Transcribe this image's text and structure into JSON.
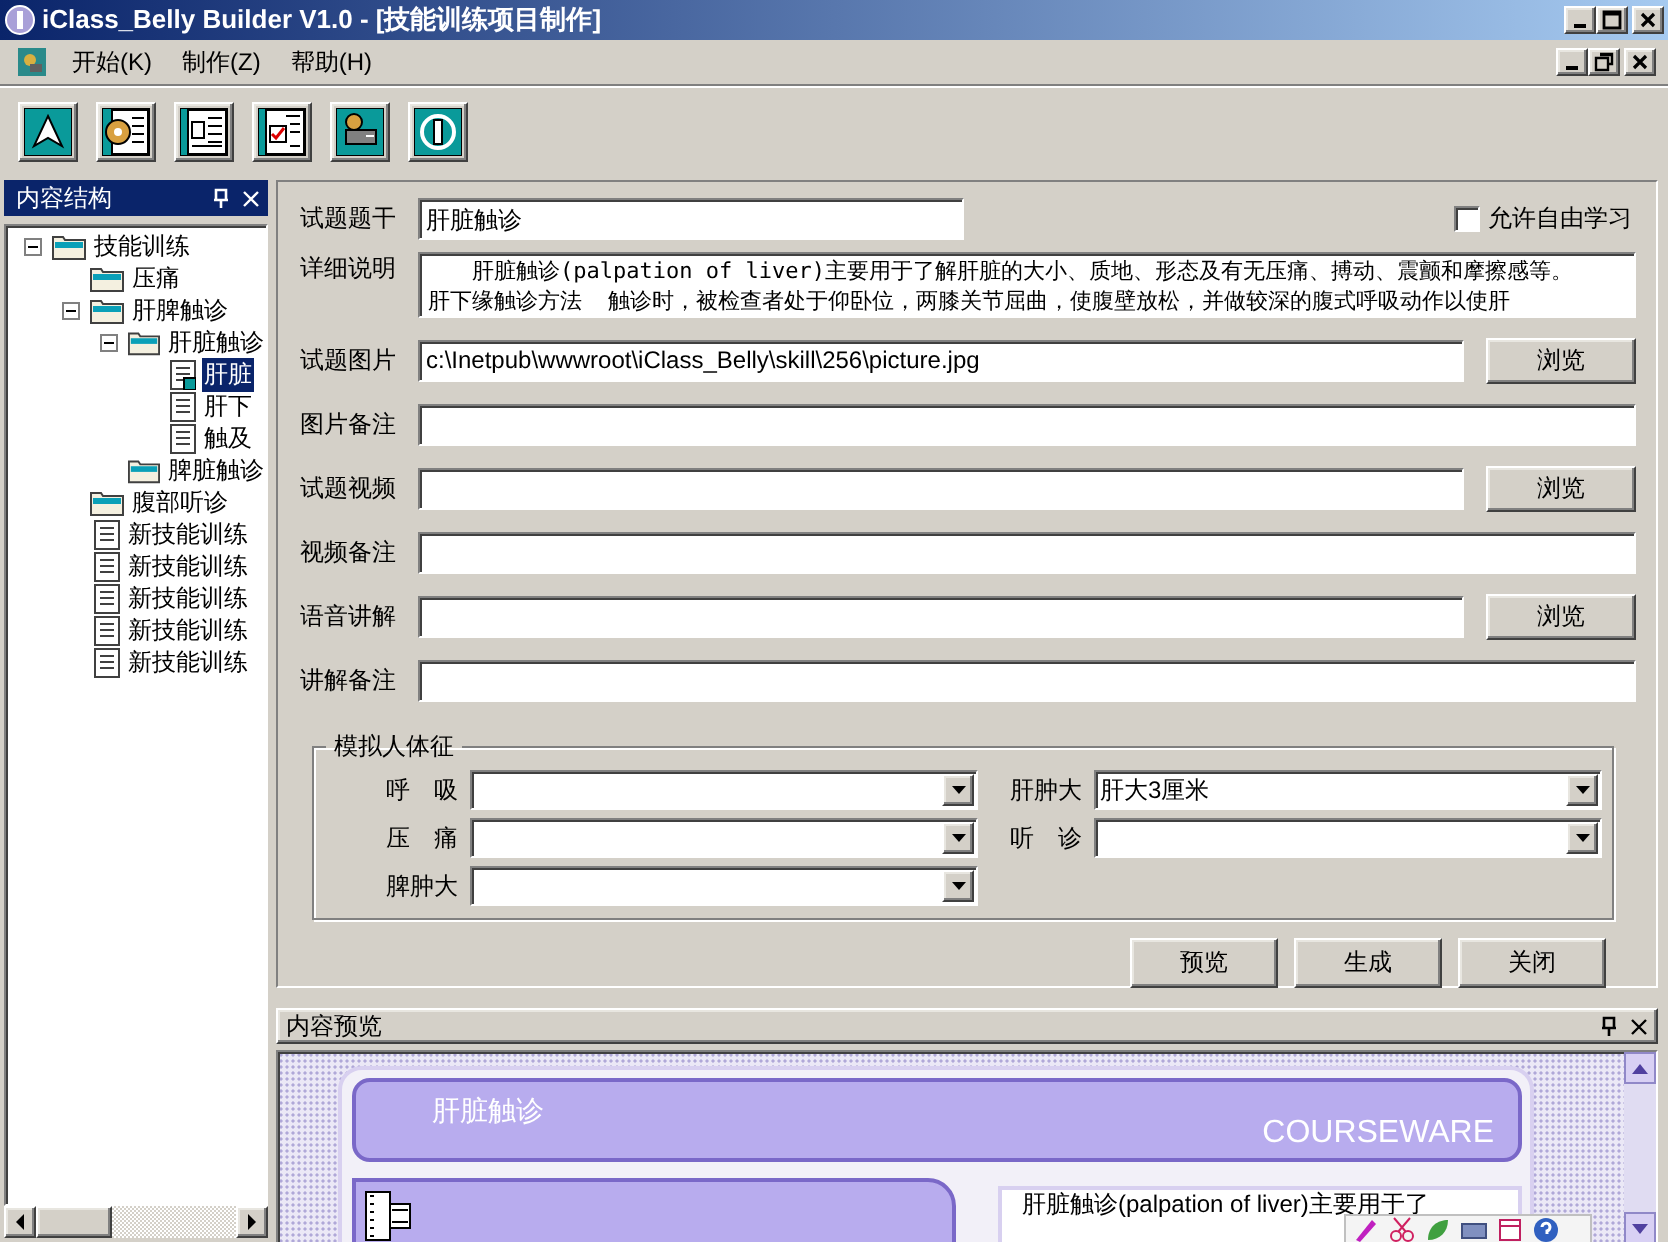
{
  "window": {
    "title": "iClass_Belly Builder V1.0 - [技能训练项目制作]"
  },
  "menu": [
    "开始(K)",
    "制作(Z)",
    "帮助(H)"
  ],
  "tree_panel": {
    "title": "内容结构",
    "tree": [
      {
        "label": "技能训练",
        "kind": "folder",
        "expanded": true,
        "selected": false,
        "children": [
          {
            "label": "压痛",
            "kind": "folder",
            "selected": false
          },
          {
            "label": "肝脾触诊",
            "kind": "folder",
            "expanded": true,
            "selected": false,
            "children": [
              {
                "label": "肝脏触诊",
                "kind": "folder",
                "expanded": true,
                "selected": false,
                "children": [
                  {
                    "label": "肝脏",
                    "kind": "page",
                    "selected": true
                  },
                  {
                    "label": "肝下",
                    "kind": "page",
                    "selected": false
                  },
                  {
                    "label": "触及",
                    "kind": "page",
                    "selected": false
                  }
                ]
              },
              {
                "label": "脾脏触诊",
                "kind": "folder",
                "selected": false
              }
            ]
          },
          {
            "label": "腹部听诊",
            "kind": "folder",
            "selected": false
          },
          {
            "label": "新技能训练",
            "kind": "page",
            "selected": false
          },
          {
            "label": "新技能训练",
            "kind": "page",
            "selected": false
          },
          {
            "label": "新技能训练",
            "kind": "page",
            "selected": false
          },
          {
            "label": "新技能训练",
            "kind": "page",
            "selected": false
          },
          {
            "label": "新技能训练",
            "kind": "page",
            "selected": false
          }
        ]
      }
    ]
  },
  "form": {
    "allow_free_study": {
      "label": "允许自由学习",
      "checked": false
    },
    "fields": [
      {
        "kind": "text",
        "label": "试题题干",
        "value": "肝脏触诊"
      },
      {
        "kind": "memo",
        "label": "详细说明",
        "lines": [
          "肝脏触诊(palpation of liver)主要用于了解肝脏的大小、质地、形态及有无压痛、搏动、震颤和摩擦感等。",
          "肝下缘触诊方法  触诊时，被检查者处于仰卧位，两膝关节屈曲，使腹壁放松，并做较深的腹式呼吸动作以使肝"
        ]
      },
      {
        "kind": "browse",
        "label": "试题图片",
        "value": "c:\\Inetpub\\wwwroot\\iClass_Belly\\skill\\256\\picture.jpg",
        "button": "浏览"
      },
      {
        "kind": "wide",
        "label": "图片备注"
      },
      {
        "kind": "browse",
        "label": "试题视频",
        "button": "浏览"
      },
      {
        "kind": "wide",
        "label": "视频备注"
      },
      {
        "kind": "browse",
        "label": "语音讲解",
        "button": "浏览"
      },
      {
        "kind": "wide",
        "label": "讲解备注"
      }
    ],
    "vitals": {
      "legend": "模拟人体征",
      "items": [
        {
          "label": "呼 吸"
        },
        {
          "label": "肝肿大",
          "value": "肝大3厘米"
        },
        {
          "label": "压 痛"
        },
        {
          "label": "听 诊"
        },
        {
          "label": "脾肿大"
        }
      ]
    },
    "actions": [
      "预览",
      "生成",
      "关闭"
    ]
  },
  "preview": {
    "title": "内容预览",
    "heading": "肝脏触诊",
    "brand": "COURSEWARE",
    "excerpt": "肝脏触诊(palpation of liver)主要用于了"
  }
}
